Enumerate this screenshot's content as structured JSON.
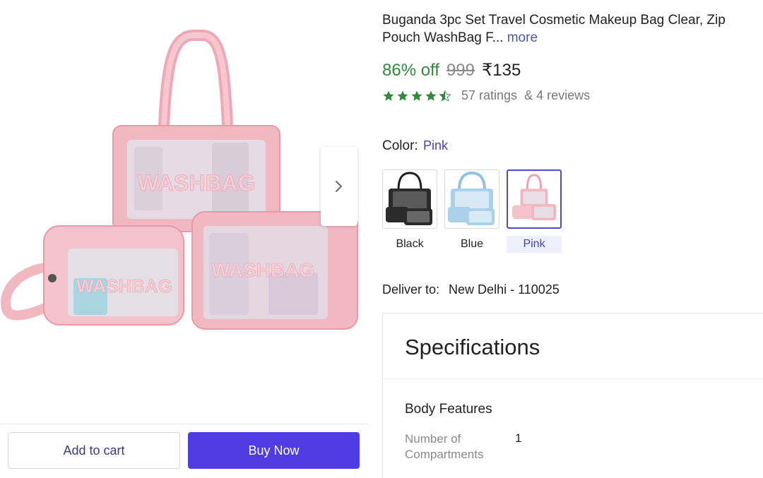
{
  "product": {
    "title_line1": "Buganda 3pc Set Travel Cosmetic Makeup Bag Clear, Zip",
    "title_line2": "Pouch WashBag F...",
    "more_link": "more",
    "discount": "86% off",
    "mrp": "999",
    "price": "₹135",
    "rating_value": 4.5,
    "ratings_count": "57 ratings",
    "reviews_count": "& 4 reviews",
    "image_label_large": "WASHBAG",
    "image_label_small": "WASHBAG",
    "image_label_medium": "WASHBAG"
  },
  "gallery": {
    "dot_count": 5,
    "active_index": 0,
    "next_icon": "chevron-right-icon"
  },
  "actions": {
    "add_to_cart": "Add to cart",
    "buy_now": "Buy Now"
  },
  "color": {
    "label": "Color:",
    "selected": "Pink",
    "options": [
      {
        "name": "Black",
        "tint": "#2b2b2b"
      },
      {
        "name": "Blue",
        "tint": "#a9d2ea"
      },
      {
        "name": "Pink",
        "tint": "#f0b7c0"
      }
    ]
  },
  "delivery": {
    "label": "Deliver to:",
    "location": "New Delhi - 110025"
  },
  "specifications": {
    "title": "Specifications",
    "section": "Body Features",
    "rows": [
      {
        "key": "Number of Compartments",
        "value": "1"
      }
    ]
  },
  "colors": {
    "accent": "#4f3de3",
    "discount_green": "#2e8b3a",
    "star_green": "#2e8b3a",
    "bag_pink": "#f2b8c2"
  }
}
